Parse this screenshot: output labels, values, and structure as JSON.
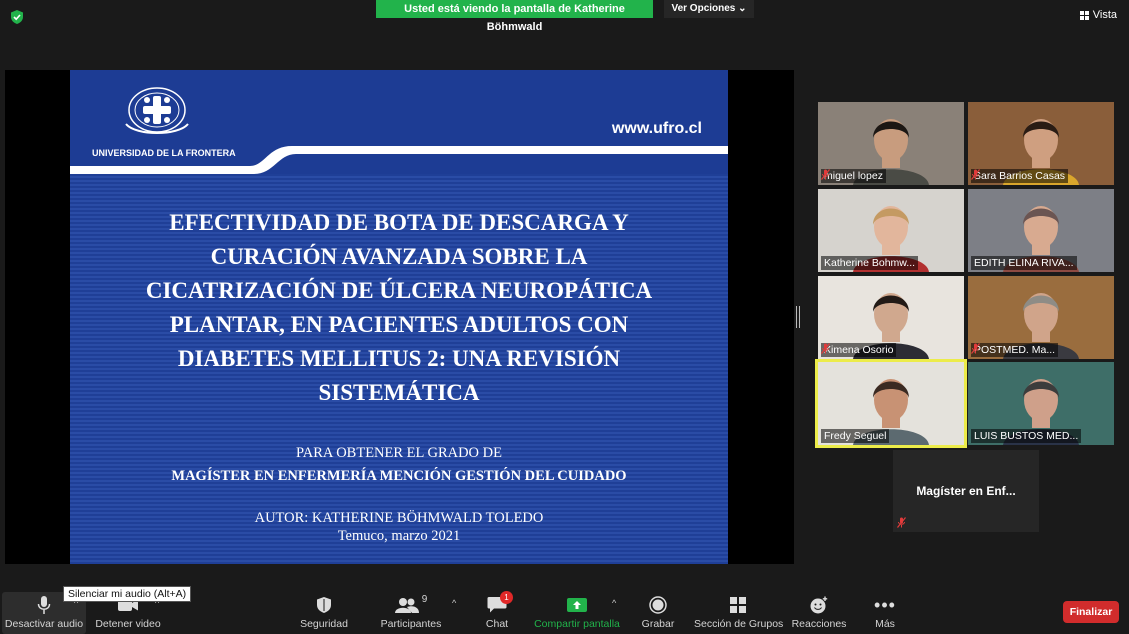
{
  "top_bar": {
    "banner": "Usted está viendo la pantalla de Katherine Böhmwald",
    "view_options": "Ver Opciones",
    "view_label": "Vista"
  },
  "slide": {
    "url": "www.ufro.cl",
    "university": "UNIVERSIDAD DE LA FRONTERA",
    "title_lines": [
      "EFECTIVIDAD DE BOTA DE DESCARGA Y",
      "CURACIÓN AVANZADA SOBRE LA",
      "CICATRIZACIÓN DE ÚLCERA NEUROPÁTICA",
      "PLANTAR, EN PACIENTES ADULTOS CON",
      "DIABETES MELLITUS 2: UNA REVISIÓN",
      "SISTEMÁTICA"
    ],
    "degree_intro": "PARA OBTENER EL GRADO DE",
    "degree": "MAGÍSTER EN ENFERMERÍA MENCIÓN GESTIÓN DEL CUIDADO",
    "author": "AUTOR: KATHERINE BÖHMWALD TOLEDO",
    "place_date": "Temuco, marzo 2021"
  },
  "participants": [
    {
      "name": "miguel lopez",
      "muted": true,
      "active": false,
      "bg": "#8a8178",
      "skin": "#c89c7e",
      "hair": "#1c1714",
      "shirt": "#4a4b45"
    },
    {
      "name": "Sara Barrios Casas",
      "muted": true,
      "active": false,
      "bg": "#8a5e3a",
      "skin": "#cf9f80",
      "hair": "#2a1c14",
      "shirt": "#d9a62c"
    },
    {
      "name": "Katherine Bohmw...",
      "muted": false,
      "active": false,
      "bg": "#d6d3ce",
      "skin": "#e2b69c",
      "hair": "#c49a62",
      "shirt": "#b23030"
    },
    {
      "name": "EDITH ELINA RIVA...",
      "muted": false,
      "active": false,
      "bg": "#7d7f86",
      "skin": "#d8aa90",
      "hair": "#6b5552",
      "shirt": "#8d4a42"
    },
    {
      "name": "Ximena Osorio",
      "muted": true,
      "active": false,
      "bg": "#e8e4de",
      "skin": "#d0a88e",
      "hair": "#221a16",
      "shirt": "#2c2c34"
    },
    {
      "name": "POSTMED. Ma...",
      "muted": true,
      "active": false,
      "bg": "#9a6d3e",
      "skin": "#d0a48a",
      "hair": "#8e8c86",
      "shirt": "#3a3a40"
    },
    {
      "name": "Fredy Seguel",
      "muted": false,
      "active": true,
      "bg": "#e4e2dc",
      "skin": "#c89274",
      "hair": "#3a2a22",
      "shirt": "#5c6a70"
    },
    {
      "name": "LUIS BUSTOS MED...",
      "muted": false,
      "active": false,
      "bg": "#3e6e68",
      "skin": "#cfa08a",
      "hair": "#3c3c3c",
      "shirt": "#2a3348"
    }
  ],
  "no_video_participant": {
    "name": "Magíster en Enf...",
    "muted": true
  },
  "toolbar": {
    "audio": "Desactivar audio",
    "video": "Detener video",
    "security": "Seguridad",
    "participants": "Participantes",
    "participants_count": "9",
    "chat": "Chat",
    "chat_badge": "1",
    "share": "Compartir pantalla",
    "record": "Grabar",
    "groups": "Sección de Grupos",
    "reactions": "Reacciones",
    "more": "Más",
    "end": "Finalizar",
    "tooltip": "Silenciar mi audio (Alt+A)"
  },
  "colors": {
    "banner_green": "#22b34b",
    "slide_blue": "#1f3f97",
    "active_speaker": "#ecec4a",
    "end_red": "#d12c2c"
  }
}
